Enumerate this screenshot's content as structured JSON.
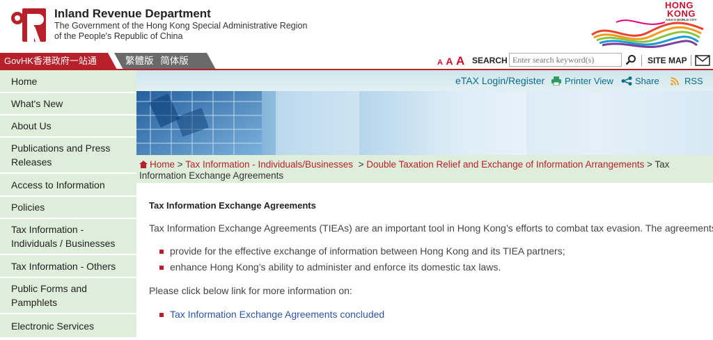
{
  "header": {
    "dept_name": "Inland Revenue Department",
    "dept_sub1": "The Government of the Hong Kong Special Administrative Region",
    "dept_sub2": "of the People's Republic of China",
    "brand_line1": "HONG",
    "brand_line2": "KONG",
    "brand_tagline": "ASIA'S WORLD CITY"
  },
  "toolbar": {
    "govhk": "GovHK香港政府一站通",
    "lang_options": "繁體版 简体版",
    "font_small": "A",
    "font_medium": "A",
    "font_large": "A",
    "search_label": "SEARCH",
    "search_placeholder": "Enter search keyword(s)",
    "sitemap": "SITE MAP"
  },
  "sidebar": {
    "items": [
      {
        "label": "Home"
      },
      {
        "label": "What's New"
      },
      {
        "label": "About Us"
      },
      {
        "label": "Publications and Press Releases"
      },
      {
        "label": "Access to Information"
      },
      {
        "label": "Policies"
      },
      {
        "label": "Tax Information - Individuals / Businesses"
      },
      {
        "label": "Tax Information - Others"
      },
      {
        "label": "Public Forms and Pamphlets"
      },
      {
        "label": "Electronic Services"
      }
    ]
  },
  "utility": {
    "etax": "eTAX Login/Register",
    "printer": "Printer View",
    "share": "Share",
    "rss": "RSS"
  },
  "breadcrumb": {
    "home": "Home",
    "sep": ">",
    "item1": "Tax Information - Individuals/Businesses",
    "item2": "Double Taxation Relief and Exchange of Information Arrangements",
    "current": "> Tax Information Exchange Agreements"
  },
  "content": {
    "title": "Tax Information Exchange Agreements",
    "intro": "Tax Information Exchange Agreements (TIEAs) are an important tool in Hong Kong’s efforts to combat tax evasion.  The agreements:",
    "bullets": [
      "provide for the effective exchange of information between Hong Kong and its TIEA partners;",
      "enhance Hong Kong’s ability to administer and enforce its domestic tax laws."
    ],
    "more_info": "Please click below link for more information on:",
    "link": "Tax Information Exchange Agreements concluded"
  },
  "colors": {
    "brand_red": "#b8202a",
    "nav_green": "#dfeeda",
    "link_blue": "#2b53a8",
    "util_teal": "#0c6b8a"
  }
}
